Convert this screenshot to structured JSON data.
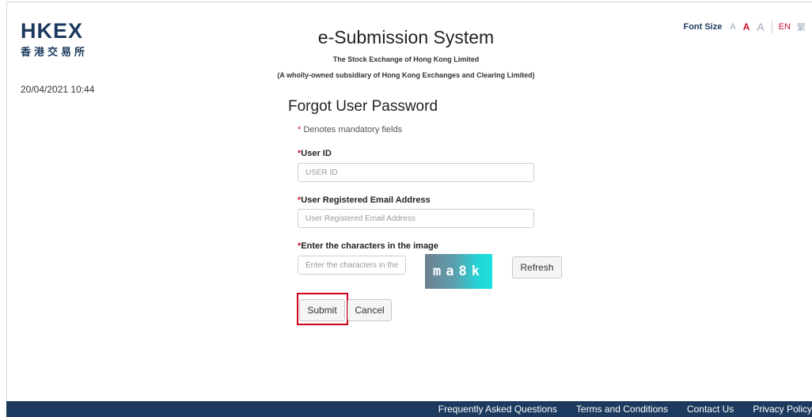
{
  "logo": {
    "main": "HKEX",
    "sub": "香港交易所"
  },
  "datetime": "20/04/2021 10:44",
  "header": {
    "title": "e-Submission System",
    "subtitle1": "The Stock Exchange of Hong Kong Limited",
    "subtitle2": "(A wholly-owned subsidiary of Hong Kong Exchanges and Clearing Limited)"
  },
  "font_bar": {
    "label": "Font Size",
    "small": "A",
    "medium": "A",
    "large": "A",
    "lang_en": "EN",
    "lang_tc": "繁"
  },
  "form": {
    "title": "Forgot User Password",
    "mandatory_star": "*",
    "mandatory_note": " Denotes mandatory fields",
    "user_id": {
      "star": "*",
      "label": "User ID",
      "placeholder": "USER ID"
    },
    "email": {
      "star": "*",
      "label": "User Registered Email Address",
      "placeholder": "User Registered Email Address"
    },
    "captcha": {
      "star": "*",
      "label": "Enter the characters in the image",
      "placeholder": "Enter the characters in the image",
      "image_text": "ma8k"
    },
    "refresh_label": "Refresh",
    "submit_label": "Submit",
    "cancel_label": "Cancel"
  },
  "footer": {
    "links": [
      "Frequently Asked Questions",
      "Terms and Conditions",
      "Contact Us",
      "Privacy Policy"
    ]
  },
  "colors": {
    "brand_navy": "#1c3a5e",
    "required_red": "#c8102e",
    "highlight_red": "#d0021b"
  }
}
